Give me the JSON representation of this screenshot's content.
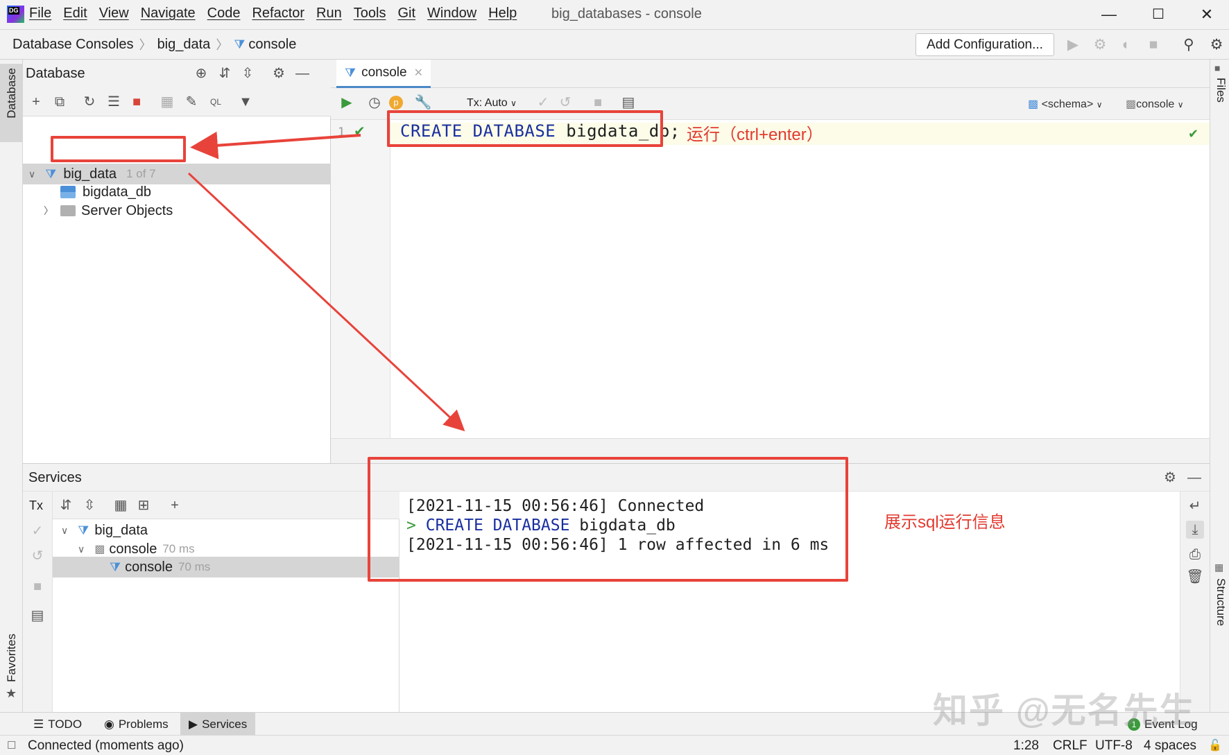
{
  "app": {
    "window_title": "big_databases - console",
    "logo_text": "DG",
    "menu": [
      "File",
      "Edit",
      "View",
      "Navigate",
      "Code",
      "Refactor",
      "Run",
      "Tools",
      "Git",
      "Window",
      "Help"
    ]
  },
  "navbar": {
    "breadcrumbs": [
      "Database Consoles",
      "big_data",
      "console"
    ],
    "add_configuration": "Add Configuration..."
  },
  "side_tabs": {
    "left_top": "Database",
    "left_bottom": "Favorites",
    "right_top": "Files",
    "right_bottom": "Structure"
  },
  "database_panel": {
    "title": "Database",
    "tree": {
      "root": {
        "label": "big_data",
        "count": "1 of 7"
      },
      "children": [
        {
          "label": "bigdata_db"
        },
        {
          "label": "Server Objects"
        }
      ]
    }
  },
  "editor": {
    "tab_label": "console",
    "tx_mode": "Tx: Auto",
    "schema_selector": "<schema>",
    "session_selector": "console",
    "line_number": "1",
    "code": {
      "kw1": "CREATE",
      "kw2": "DATABASE",
      "ident": "bigdata_db",
      "end": ";"
    }
  },
  "services": {
    "title": "Services",
    "tx_label": "Tx",
    "tree": [
      {
        "label": "big_data",
        "time": ""
      },
      {
        "label": "console",
        "time": "70 ms"
      },
      {
        "label": "console",
        "time": "70 ms"
      }
    ],
    "output": {
      "line1": "[2021-11-15 00:56:46] Connected",
      "line2_prompt": ">",
      "line2_kw": "CREATE DATABASE",
      "line2_ident": "bigdata_db",
      "line3": "[2021-11-15 00:56:46] 1 row affected in 6 ms"
    }
  },
  "tool_windows": {
    "todo": "TODO",
    "problems": "Problems",
    "services": "Services",
    "event_log": "Event Log",
    "event_count": "1"
  },
  "statusbar": {
    "message": "Connected (moments ago)",
    "position": "1:28",
    "line_sep": "CRLF",
    "encoding": "UTF-8",
    "indent": "4 spaces"
  },
  "annotations": {
    "run_hint": "运行（ctrl+enter）",
    "output_hint": "展示sql运行信息",
    "watermark": "知乎 @无名先生"
  },
  "colors": {
    "annotation_red": "#e8433a",
    "keyword_blue": "#1a2fa0",
    "run_green": "#3b9a3b"
  }
}
